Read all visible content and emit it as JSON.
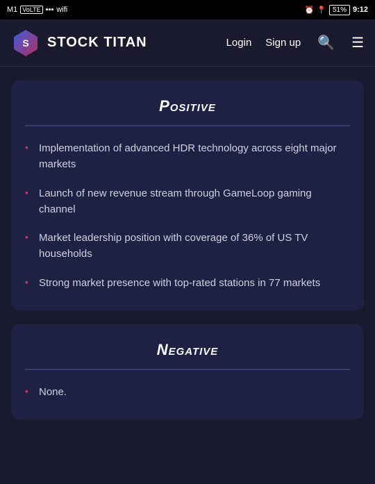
{
  "statusBar": {
    "carrier": "M1",
    "volte": "VoLTE",
    "time": "9:12",
    "battery": "51"
  },
  "navbar": {
    "brandText": "STOCK TITAN",
    "loginLabel": "Login",
    "signupLabel": "Sign up"
  },
  "positive": {
    "title": "Positive",
    "items": [
      "Implementation of advanced HDR technology across eight major markets",
      "Launch of new revenue stream through GameLoop gaming channel",
      "Market leadership position with coverage of 36% of US TV households",
      "Strong market presence with top-rated stations in 77 markets"
    ]
  },
  "negative": {
    "title": "Negative",
    "items": [
      "None."
    ]
  }
}
